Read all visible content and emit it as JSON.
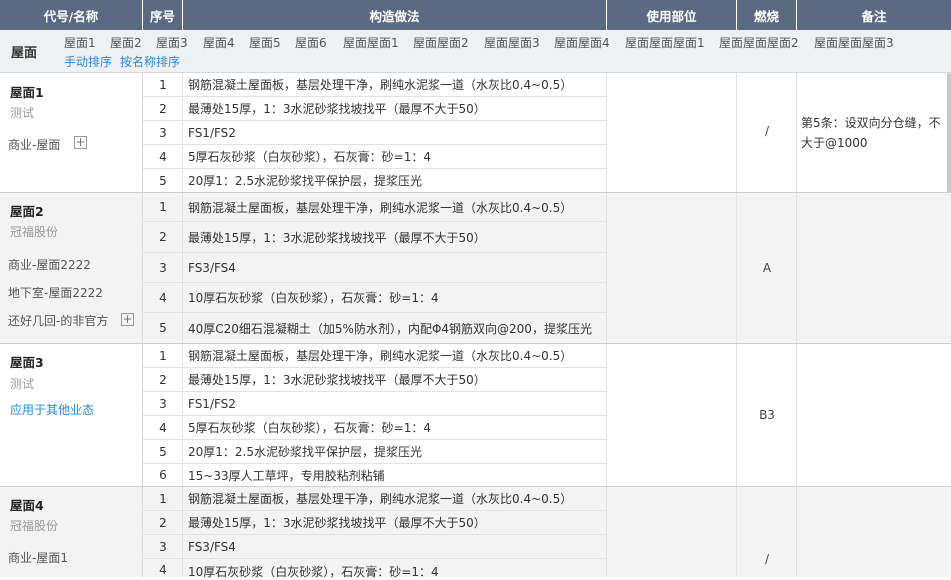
{
  "columns": {
    "name": "代号/名称",
    "seq": "序号",
    "method": "构造做法",
    "location": "使用部位",
    "burn": "燃烧",
    "remark": "备注"
  },
  "filter": {
    "category": "屋面",
    "tags": [
      "屋面1",
      "屋面2",
      "屋面3",
      "屋面4",
      "屋面5",
      "屋面6",
      "屋面屋面1",
      "屋面屋面2",
      "屋面屋面3",
      "屋面屋面4",
      "屋面屋面屋面1",
      "屋面屋面屋面2",
      "屋面屋面屋面3"
    ],
    "sort_manual": "手动排序",
    "sort_name": "按名称排序"
  },
  "groups": [
    {
      "title": "屋面1",
      "subtitle": "测试",
      "tags": [
        "商业-屋面"
      ],
      "burn": "/",
      "remark": [
        "第5条：设双向分仓缝，不",
        "大于@1000"
      ],
      "rows": [
        {
          "n": "1",
          "t": "钢筋混凝土屋面板，基层处理干净，刷纯水泥浆一道（水灰比0.4~0.5）"
        },
        {
          "n": "2",
          "t": "最薄处15厚，1：3水泥砂浆找坡找平（最厚不大于50）"
        },
        {
          "n": "3",
          "t": "FS1/FS2"
        },
        {
          "n": "4",
          "t": "5厚石灰砂浆（白灰砂浆），石灰膏：砂=1：4"
        },
        {
          "n": "5",
          "t": "20厚1：2.5水泥砂浆找平保护层，提浆压光"
        }
      ]
    },
    {
      "title": "屋面2",
      "subtitle": "冠福股份",
      "tags": [
        "商业-屋面2222",
        "地下室-屋面2222",
        "还好几回-的非官方"
      ],
      "burn": "A",
      "remark": [],
      "rows": [
        {
          "n": "1",
          "t": "钢筋混凝土屋面板，基层处理干净，刷纯水泥浆一道（水灰比0.4~0.5）"
        },
        {
          "n": "2",
          "t": "最薄处15厚，1：3水泥砂浆找坡找平（最厚不大于50）"
        },
        {
          "n": "3",
          "t": "FS3/FS4"
        },
        {
          "n": "4",
          "t": "10厚石灰砂浆（白灰砂浆），石灰膏：砂=1：4"
        },
        {
          "n": "5",
          "t": "40厚C20细石混凝糊土（加5%防水剂），内配Φ4钢筋双向@200，提浆压光"
        }
      ]
    },
    {
      "title": "屋面3",
      "subtitle": "测试",
      "link": "应用于其他业态",
      "tags": [],
      "burn": "B3",
      "remark": [],
      "rows": [
        {
          "n": "1",
          "t": "钢筋混凝土屋面板，基层处理干净，刷纯水泥浆一道（水灰比0.4~0.5）"
        },
        {
          "n": "2",
          "t": "最薄处15厚，1：3水泥砂浆找坡找平（最厚不大于50）"
        },
        {
          "n": "3",
          "t": "FS1/FS2"
        },
        {
          "n": "4",
          "t": "5厚石灰砂浆（白灰砂浆），石灰膏：砂=1：4"
        },
        {
          "n": "5",
          "t": "20厚1：2.5水泥砂浆找平保护层，提浆压光"
        },
        {
          "n": "6",
          "t": "15~33厚人工草坪，专用胶粘剂粘铺"
        }
      ]
    },
    {
      "title": "屋面4",
      "subtitle": "冠福股份",
      "tags": [
        "商业-屋面1"
      ],
      "burn": "/",
      "remark": [],
      "rows": [
        {
          "n": "1",
          "t": "钢筋混凝土屋面板，基层处理干净，刷纯水泥浆一道（水灰比0.4~0.5）"
        },
        {
          "n": "2",
          "t": "最薄处15厚，1：3水泥砂浆找坡找平（最厚不大于50）"
        },
        {
          "n": "3",
          "t": "FS3/FS4"
        },
        {
          "n": "4",
          "t": "10厚石灰砂浆（白灰砂浆），石灰膏：砂=1：4"
        }
      ]
    }
  ]
}
